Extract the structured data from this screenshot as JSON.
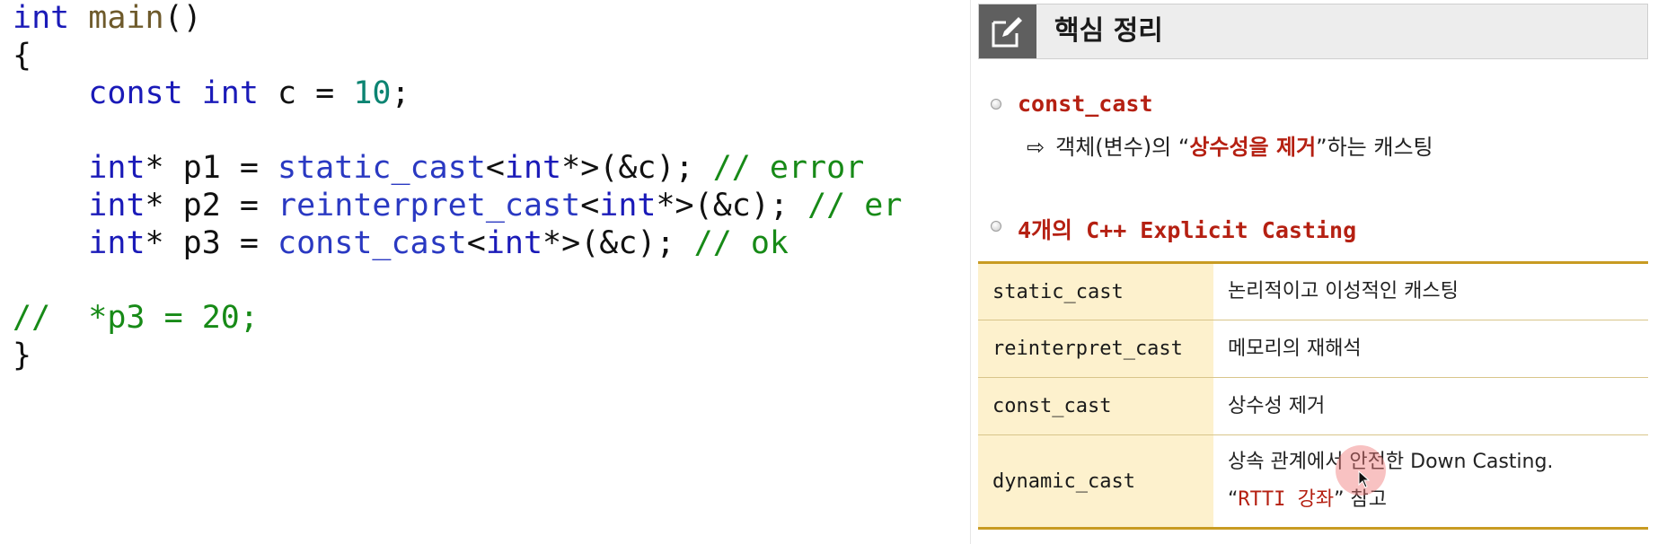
{
  "editor": {
    "lines": {
      "l1": {
        "kw": "int",
        "fn": "main",
        "rest": "()"
      },
      "l2": {
        "text": "{"
      },
      "l3": {
        "indent": "    ",
        "kw1": "const",
        "kw2": "int",
        "mid": " c = ",
        "num": "10",
        "end": ";"
      },
      "l5": {
        "indent": "    ",
        "kw": "int",
        "mid": "* p1 = ",
        "cast": "static_cast",
        "lt": "<",
        "tkw": "int",
        "tail": "*>(&c); ",
        "cmt": "// error"
      },
      "l6": {
        "indent": "    ",
        "kw": "int",
        "mid": "* p2 = ",
        "cast": "reinterpret_cast",
        "lt": "<",
        "tkw": "int",
        "tail": "*>(&c); ",
        "cmt": "// er"
      },
      "l7": {
        "indent": "    ",
        "kw": "int",
        "mid": "* p3 = ",
        "cast": "const_cast",
        "lt": "<",
        "tkw": "int",
        "tail": "*>(&c); ",
        "cmt": "// ok"
      },
      "l9": {
        "cmt": "//  *p3 = 20;"
      },
      "l10": {
        "text": "}"
      }
    }
  },
  "panel": {
    "icon": "edit-icon",
    "title": "핵심 정리",
    "section1": {
      "title": "const_cast",
      "arrow": "⇨",
      "desc_before": "객체(변수)의 “",
      "desc_highlight": "상수성을 제거",
      "desc_after": "”하는 캐스팅"
    },
    "section2": {
      "title": "4개의 C++ Explicit Casting"
    },
    "table": {
      "rows": [
        {
          "key": "static_cast",
          "value": "논리적이고 이성적인 캐스팅"
        },
        {
          "key": "reinterpret_cast",
          "value": "메모리의 재해석"
        },
        {
          "key": "const_cast",
          "value": "상수성 제거"
        },
        {
          "key": "dynamic_cast",
          "value": "상속 관계에서 안전한 Down Casting.",
          "value2_open": "“",
          "value2_link": "RTTI 강좌",
          "value2_close": "” 참고"
        }
      ]
    },
    "colors": {
      "accent_red": "#b52012",
      "table_border": "#c89b22",
      "table_key_bg": "#fdf1cd",
      "keyword": "#1a1ab8",
      "comment": "#178a17",
      "number": "#0c8472"
    }
  }
}
